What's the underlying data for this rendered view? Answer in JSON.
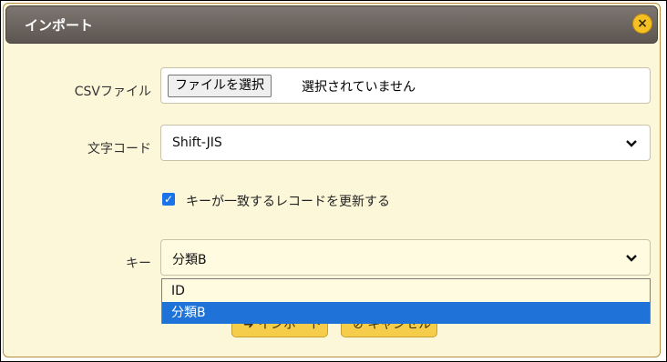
{
  "dialog": {
    "title": "インポート",
    "close_icon": "×"
  },
  "form": {
    "csv_label": "CSVファイル",
    "file_button_label": "ファイルを選択",
    "file_status": "選択されていません",
    "encoding_label": "文字コード",
    "encoding_value": "Shift-JIS",
    "update_checkbox_label": "キーが一致するレコードを更新する",
    "update_checked": true,
    "key_label": "キー",
    "key_value": "分類B",
    "key_options": [
      "ID",
      "分類B"
    ],
    "key_selected_option": "分類B"
  },
  "footer": {
    "import_label": "インポート",
    "cancel_label": "キャンセル"
  },
  "colors": {
    "dialog_bg": "#fdf7da",
    "titlebar": "#6b645f",
    "accent_button": "#f5cd4a",
    "checkbox": "#1a73e8",
    "selected_option": "#1e72d8"
  }
}
